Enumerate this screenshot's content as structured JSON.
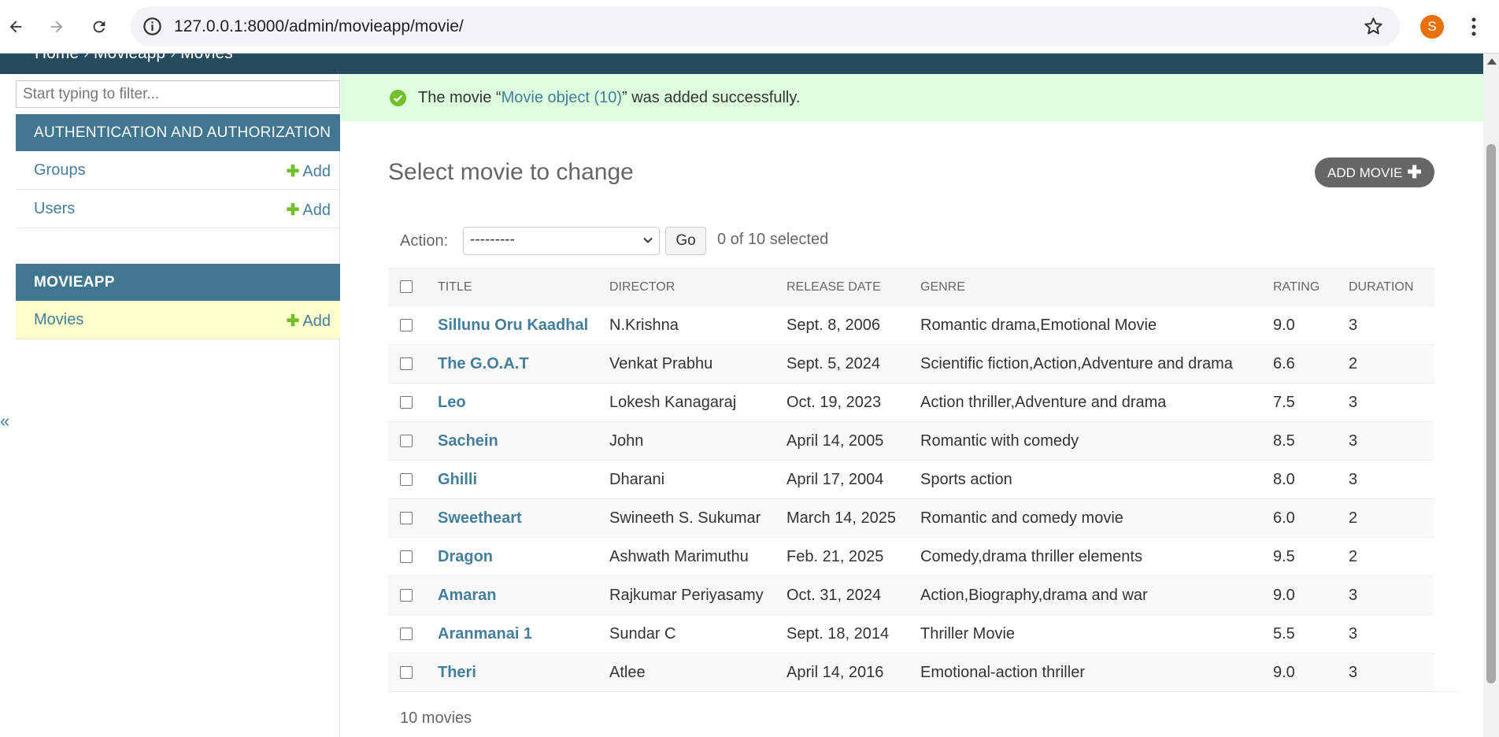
{
  "browser": {
    "url": "127.0.0.1:8000/admin/movieapp/movie/",
    "profile_initial": "S"
  },
  "breadcrumb": {
    "home": "Home",
    "app": "Movieapp",
    "current": "Movies",
    "separator": "›"
  },
  "sidebar": {
    "filter_placeholder": "Start typing to filter...",
    "collapse_glyph": "«",
    "modules": [
      {
        "caption": "AUTHENTICATION AND AUTHORIZATION",
        "models": [
          {
            "name": "Groups",
            "add": "Add"
          },
          {
            "name": "Users",
            "add": "Add"
          }
        ]
      },
      {
        "caption": "MOVIEAPP",
        "models": [
          {
            "name": "Movies",
            "add": "Add"
          }
        ]
      }
    ]
  },
  "message": {
    "prefix": "The movie “",
    "link": "Movie object (10)",
    "suffix": "” was added successfully."
  },
  "content": {
    "title": "Select movie to change",
    "add_button": "ADD MOVIE",
    "action_label": "Action:",
    "action_value": "---------",
    "go": "Go",
    "selected_count": "0 of 10 selected",
    "paginator": "10 movies"
  },
  "table": {
    "headers": [
      "TITLE",
      "DIRECTOR",
      "RELEASE DATE",
      "GENRE",
      "RATING",
      "DURATION"
    ],
    "rows": [
      [
        "Sillunu Oru Kaadhal",
        "N.Krishna",
        "Sept. 8, 2006",
        "Romantic drama,Emotional Movie",
        "9.0",
        "3"
      ],
      [
        "The G.O.A.T",
        "Venkat Prabhu",
        "Sept. 5, 2024",
        "Scientific fiction,Action,Adventure and drama",
        "6.6",
        "2"
      ],
      [
        "Leo",
        "Lokesh Kanagaraj",
        "Oct. 19, 2023",
        "Action thriller,Adventure and drama",
        "7.5",
        "3"
      ],
      [
        "Sachein",
        "John",
        "April 14, 2005",
        "Romantic with comedy",
        "8.5",
        "3"
      ],
      [
        "Ghilli",
        "Dharani",
        "April 17, 2004",
        "Sports action",
        "8.0",
        "3"
      ],
      [
        "Sweetheart",
        "Swineeth S. Sukumar",
        "March 14, 2025",
        "Romantic and comedy movie",
        "6.0",
        "2"
      ],
      [
        "Dragon",
        "Ashwath Marimuthu",
        "Feb. 21, 2025",
        "Comedy,drama thriller elements",
        "9.5",
        "2"
      ],
      [
        "Amaran",
        "Rajkumar Periyasamy",
        "Oct. 31, 2024",
        "Action,Biography,drama and war",
        "9.0",
        "3"
      ],
      [
        "Aranmanai 1",
        "Sundar C",
        "Sept. 18, 2014",
        "Thriller Movie",
        "5.5",
        "3"
      ],
      [
        "Theri",
        "Atlee",
        "April 14, 2016",
        "Emotional-action thriller",
        "9.0",
        "3"
      ]
    ]
  },
  "colors": {
    "header": "#264b5d",
    "module": "#417690",
    "link": "#447e9b",
    "success_bg": "#dddddd",
    "add_plus": "#70bf2b"
  }
}
